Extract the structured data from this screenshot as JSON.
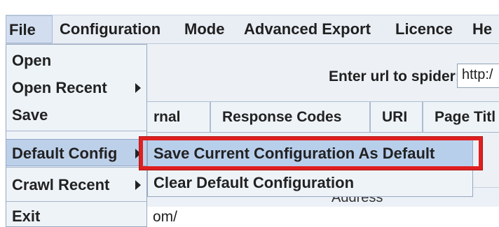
{
  "menubar": {
    "items": [
      "File",
      "Configuration",
      "Mode",
      "Advanced Export",
      "Licence",
      "He"
    ]
  },
  "main": {
    "spider_label": "Enter url to spider:",
    "url_value": "http:/"
  },
  "tabs": [
    "rnal",
    "Response Codes",
    "URI",
    "Page Titl"
  ],
  "table": {
    "header": "Address",
    "row_fragment": "om/"
  },
  "file_menu": {
    "items": [
      "Open",
      "Open Recent",
      "Save",
      "Default Config",
      "Crawl Recent",
      "Exit"
    ]
  },
  "submenu": {
    "items": [
      "Save Current Configuration As Default",
      "Clear Default Configuration"
    ]
  },
  "colors": {
    "highlight_box": "#df1f1f",
    "menu_background": "#eef3f8",
    "selected_item": "#bdd0ea"
  }
}
